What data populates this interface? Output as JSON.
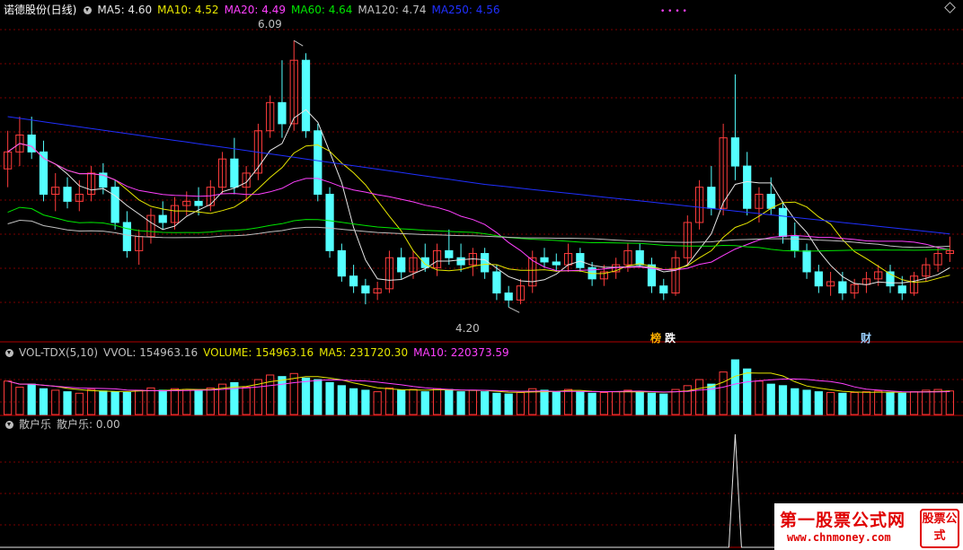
{
  "colors": {
    "up": "#ff3c3c",
    "down": "#54ffff",
    "grid": "#7a0000",
    "ma5": "#e6e6e6",
    "ma10": "#e6e600",
    "ma20": "#ff40ff",
    "ma60": "#00e600",
    "ma120": "#c0c0c0",
    "ma250": "#2030ff"
  },
  "main_header": {
    "title": "诺德股份(日线)",
    "ma5": "MA5: 4.60",
    "ma10": "MA10: 4.52",
    "ma20": "MA20: 4.49",
    "ma60": "MA60: 4.64",
    "ma120": "MA120: 4.74",
    "ma250": "MA250: 4.56"
  },
  "vol_header": {
    "name": "VOL-TDX(5,10)",
    "vvol": "VVOL: 154963.16",
    "volume": "VOLUME: 154963.16",
    "ma5": "MA5: 231720.30",
    "ma10": "MA10: 220373.59"
  },
  "ind_header": {
    "name": "散户乐",
    "value": "散户乐: 0.00"
  },
  "annotations": {
    "high": "6.09",
    "low": "4.20",
    "tag1": "榜",
    "tag2": "跌",
    "tag3": "财",
    "dots": "• • • •"
  },
  "watermark": {
    "title": "第一股票公式网",
    "url": "www.chnmoney.com",
    "logo": "股票公式"
  },
  "chart_data": [
    {
      "type": "candlestick",
      "title": "诺德股份(日线)",
      "ylim": [
        4.1,
        6.25
      ],
      "candles": [
        [
          5.18,
          5.45,
          5.05,
          5.3
        ],
        [
          5.3,
          5.55,
          5.2,
          5.42
        ],
        [
          5.42,
          5.55,
          5.25,
          5.3
        ],
        [
          5.3,
          5.38,
          4.95,
          5.0
        ],
        [
          5.0,
          5.15,
          4.88,
          5.05
        ],
        [
          5.05,
          5.12,
          4.9,
          4.95
        ],
        [
          4.95,
          5.1,
          4.88,
          5.0
        ],
        [
          5.0,
          5.2,
          4.95,
          5.15
        ],
        [
          5.15,
          5.22,
          5.0,
          5.05
        ],
        [
          5.05,
          5.1,
          4.75,
          4.8
        ],
        [
          4.8,
          4.88,
          4.55,
          4.6
        ],
        [
          4.6,
          4.75,
          4.5,
          4.7
        ],
        [
          4.7,
          4.9,
          4.65,
          4.85
        ],
        [
          4.85,
          4.95,
          4.75,
          4.8
        ],
        [
          4.8,
          4.98,
          4.75,
          4.92
        ],
        [
          4.92,
          5.02,
          4.85,
          4.95
        ],
        [
          4.95,
          5.05,
          4.85,
          4.92
        ],
        [
          4.92,
          5.1,
          4.88,
          5.05
        ],
        [
          5.05,
          5.3,
          5.0,
          5.25
        ],
        [
          5.25,
          5.4,
          5.0,
          5.05
        ],
        [
          5.05,
          5.2,
          4.95,
          5.15
        ],
        [
          5.15,
          5.5,
          5.1,
          5.45
        ],
        [
          5.45,
          5.7,
          5.4,
          5.65
        ],
        [
          5.65,
          5.95,
          5.4,
          5.5
        ],
        [
          5.5,
          6.09,
          5.45,
          5.95
        ],
        [
          5.95,
          6.0,
          5.4,
          5.45
        ],
        [
          5.45,
          5.5,
          4.95,
          5.0
        ],
        [
          5.0,
          5.05,
          4.55,
          4.6
        ],
        [
          4.6,
          4.65,
          4.38,
          4.42
        ],
        [
          4.42,
          4.5,
          4.3,
          4.35
        ],
        [
          4.35,
          4.4,
          4.22,
          4.3
        ],
        [
          4.3,
          4.38,
          4.25,
          4.33
        ],
        [
          4.33,
          4.6,
          4.3,
          4.55
        ],
        [
          4.55,
          4.62,
          4.4,
          4.45
        ],
        [
          4.45,
          4.6,
          4.4,
          4.55
        ],
        [
          4.55,
          4.65,
          4.45,
          4.48
        ],
        [
          4.48,
          4.65,
          4.42,
          4.6
        ],
        [
          4.6,
          4.75,
          4.5,
          4.55
        ],
        [
          4.55,
          4.65,
          4.45,
          4.5
        ],
        [
          4.5,
          4.62,
          4.42,
          4.58
        ],
        [
          4.58,
          4.62,
          4.4,
          4.45
        ],
        [
          4.45,
          4.5,
          4.25,
          4.3
        ],
        [
          4.3,
          4.35,
          4.2,
          4.25
        ],
        [
          4.25,
          4.4,
          4.22,
          4.35
        ],
        [
          4.35,
          4.6,
          4.3,
          4.55
        ],
        [
          4.55,
          4.62,
          4.48,
          4.52
        ],
        [
          4.52,
          4.58,
          4.45,
          4.5
        ],
        [
          4.5,
          4.65,
          4.45,
          4.58
        ],
        [
          4.58,
          4.62,
          4.45,
          4.48
        ],
        [
          4.48,
          4.52,
          4.35,
          4.4
        ],
        [
          4.4,
          4.5,
          4.35,
          4.45
        ],
        [
          4.45,
          4.55,
          4.4,
          4.5
        ],
        [
          4.5,
          4.65,
          4.45,
          4.6
        ],
        [
          4.6,
          4.65,
          4.48,
          4.5
        ],
        [
          4.5,
          4.55,
          4.3,
          4.35
        ],
        [
          4.35,
          4.4,
          4.25,
          4.3
        ],
        [
          4.3,
          4.6,
          4.28,
          4.55
        ],
        [
          4.55,
          4.85,
          4.5,
          4.8
        ],
        [
          4.8,
          5.1,
          4.75,
          5.05
        ],
        [
          5.05,
          5.2,
          4.85,
          4.9
        ],
        [
          4.9,
          5.5,
          4.85,
          5.4
        ],
        [
          5.4,
          5.85,
          5.1,
          5.2
        ],
        [
          5.2,
          5.3,
          4.85,
          4.9
        ],
        [
          4.9,
          5.05,
          4.8,
          5.0
        ],
        [
          5.0,
          5.12,
          4.85,
          4.9
        ],
        [
          4.9,
          4.95,
          4.65,
          4.7
        ],
        [
          4.7,
          4.8,
          4.55,
          4.6
        ],
        [
          4.6,
          4.65,
          4.4,
          4.45
        ],
        [
          4.45,
          4.5,
          4.3,
          4.35
        ],
        [
          4.35,
          4.45,
          4.28,
          4.38
        ],
        [
          4.38,
          4.45,
          4.25,
          4.3
        ],
        [
          4.3,
          4.4,
          4.26,
          4.36
        ],
        [
          4.36,
          4.45,
          4.3,
          4.4
        ],
        [
          4.4,
          4.5,
          4.35,
          4.45
        ],
        [
          4.45,
          4.5,
          4.3,
          4.35
        ],
        [
          4.35,
          4.42,
          4.25,
          4.3
        ],
        [
          4.3,
          4.45,
          4.28,
          4.42
        ],
        [
          4.42,
          4.55,
          4.38,
          4.5
        ],
        [
          4.5,
          4.62,
          4.45,
          4.58
        ],
        [
          4.58,
          4.7,
          4.52,
          4.6
        ]
      ]
    },
    {
      "type": "bar",
      "title": "VOL-TDX(5,10)",
      "values": [
        220000,
        180000,
        200000,
        170000,
        160000,
        150000,
        140000,
        165000,
        155000,
        150000,
        145000,
        160000,
        175000,
        160000,
        170000,
        165000,
        155000,
        175000,
        200000,
        210000,
        180000,
        230000,
        260000,
        250000,
        270000,
        240000,
        230000,
        210000,
        190000,
        170000,
        160000,
        150000,
        175000,
        160000,
        165000,
        150000,
        170000,
        165000,
        150000,
        160000,
        150000,
        140000,
        135000,
        145000,
        170000,
        160000,
        150000,
        165000,
        150000,
        140000,
        145000,
        150000,
        160000,
        150000,
        140000,
        135000,
        165000,
        190000,
        230000,
        200000,
        280000,
        360000,
        300000,
        220000,
        200000,
        190000,
        170000,
        160000,
        150000,
        145000,
        140000,
        145000,
        150000,
        155000,
        145000,
        140000,
        150000,
        160000,
        165000,
        155000
      ]
    },
    {
      "type": "line",
      "title": "散户乐",
      "values": [
        0,
        0,
        0,
        0,
        0,
        0,
        0,
        0,
        0,
        0,
        0,
        0,
        0,
        0,
        0,
        0,
        0,
        0,
        0,
        0,
        0,
        0,
        0,
        0,
        0,
        0,
        0,
        0,
        0,
        0,
        0,
        0,
        0,
        0,
        0,
        0,
        0,
        0,
        0,
        0,
        0,
        0,
        0,
        0,
        0,
        0,
        0,
        0,
        0,
        0,
        0,
        0,
        0,
        0,
        0,
        0,
        0,
        0,
        0,
        0,
        0,
        0,
        0,
        0,
        0,
        0,
        0,
        0,
        0,
        0,
        0,
        0,
        0,
        0,
        0,
        0,
        0,
        0,
        0,
        0
      ]
    }
  ]
}
